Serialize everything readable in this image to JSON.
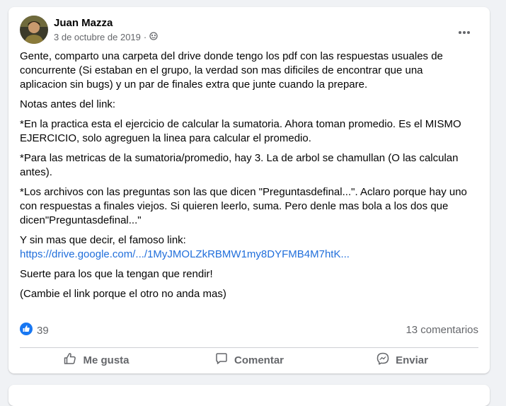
{
  "post": {
    "author": "Juan Mazza",
    "date": "3 de octubre de 2019",
    "separator": "·",
    "audience_icon": "public-globe-icon",
    "more_icon": "more-options-icon",
    "paragraphs": [
      "Gente, comparto una carpeta del drive donde tengo los pdf con las respuestas usuales de concurrente (Si estaban en el grupo, la verdad son mas dificiles de encontrar que una aplicacion sin bugs) y un par de finales extra que junte cuando la prepare.",
      "Notas antes del link:",
      "*En la practica esta el ejercicio de calcular la sumatoria. Ahora toman promedio. Es el MISMO EJERCICIO, solo agreguen la linea para calcular el promedio.",
      "*Para las metricas de la sumatoria/promedio, hay 3. La de arbol se chamullan (O las calculan antes).",
      "*Los archivos con las preguntas son las que dicen \"Preguntasdefinal...\". Aclaro porque hay uno con respuestas a finales viejos. Si quieren leerlo, suma. Pero denle mas bola a los dos que dicen\"Preguntasdefinal...\""
    ],
    "link_intro": "Y sin mas que decir, el famoso link:",
    "link_text": "https://drive.google.com/.../1MyJMOLZkRBMW1my8DYFMB4M7htK...",
    "closing": [
      "Suerte para los que la tengan que rendir!",
      "(Cambie el link porque el otro no anda mas)"
    ],
    "like_count": "39",
    "comments_count": "13 comentarios",
    "actions": {
      "like": "Me gusta",
      "comment": "Comentar",
      "share": "Enviar"
    }
  },
  "colors": {
    "link": "#216fdb",
    "like_blue": "#1877f2",
    "muted": "#65676b",
    "background": "#f0f2f5"
  }
}
